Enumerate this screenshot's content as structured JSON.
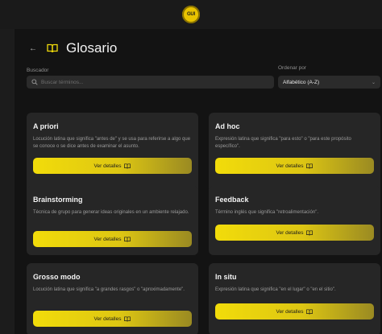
{
  "app": {
    "logo_text": "GUI"
  },
  "page": {
    "title": "Glosario"
  },
  "search": {
    "label": "Buscador",
    "placeholder": "Buscar términos..."
  },
  "sort": {
    "label": "Ordenar por",
    "selected": "Alfabético (A-Z)"
  },
  "cards": [
    {
      "title": "A priori",
      "description": "Locución latina que significa \"antes de\" y se usa para referirse a algo que se conoce o se dice antes de examinar el asunto.",
      "button": "Ver detalles"
    },
    {
      "title": "Ad hoc",
      "description": "Expresión latina que significa \"para esto\" o \"para este propósito específico\".",
      "button": "Ver detalles"
    },
    {
      "title": "Brainstorming",
      "description": "Técnica de grupo para generar ideas originales en un ambiente relajado.",
      "button": "Ver detalles"
    },
    {
      "title": "Feedback",
      "description": "Término inglés que significa \"retroalimentación\".",
      "button": "Ver detalles"
    },
    {
      "title": "Grosso modo",
      "description": "Locución latina que significa \"a grandes rasgos\" o \"aproximadamente\".",
      "button": "Ver detalles"
    },
    {
      "title": "In situ",
      "description": "Expresión latina que significa \"en el lugar\" o \"en el sitio\".",
      "button": "Ver detalles"
    }
  ],
  "colors": {
    "accent": "#f2dc0a",
    "card": "#262626",
    "background": "#131313"
  }
}
